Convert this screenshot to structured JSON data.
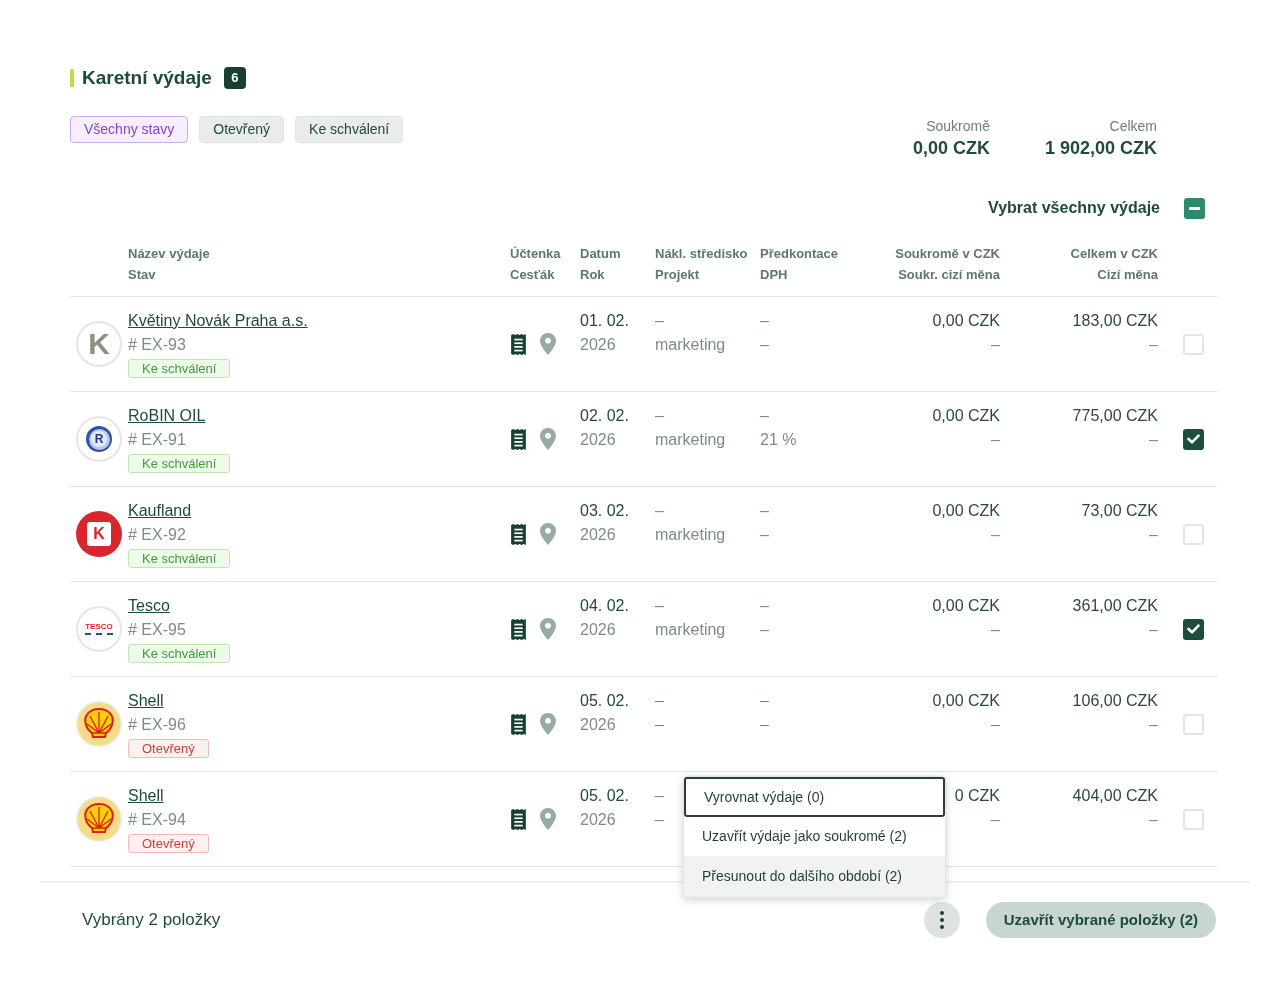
{
  "header": {
    "title": "Karetní výdaje",
    "count": "6"
  },
  "filters": [
    {
      "label": "Všechny stavy",
      "selected": true
    },
    {
      "label": "Otevřený",
      "selected": false
    },
    {
      "label": "Ke schválení",
      "selected": false
    }
  ],
  "totals": [
    {
      "label": "Soukromě",
      "value": "0,00 CZK"
    },
    {
      "label": "Celkem",
      "value": "1 902,00 CZK"
    }
  ],
  "select_all": {
    "label": "Vybrat všechny výdaje",
    "indeterminate": true
  },
  "table": {
    "columns": [
      {
        "title": "Název výdaje",
        "subtitle": "Stav",
        "kind": "text"
      },
      {
        "title": "Účtenka",
        "subtitle": "Cesťák",
        "kind": "text"
      },
      {
        "title": "Datum",
        "subtitle": "Rok",
        "kind": "text"
      },
      {
        "title": "Nákl. středisko",
        "subtitle": "Projekt",
        "kind": "text"
      },
      {
        "title": "Předkontace",
        "subtitle": "DPH",
        "kind": "text"
      },
      {
        "title": "Soukromě v CZK",
        "subtitle": "Soukr. cizí měna",
        "kind": "amount"
      },
      {
        "title": "Celkem v CZK",
        "subtitle": "Cizí měna",
        "kind": "amount"
      }
    ],
    "rows": [
      {
        "logo": {
          "kind": "letter",
          "text": "K"
        },
        "name": "Květiny Novák Praha a.s.",
        "number": "# EX-93",
        "status": {
          "label": "Ke schválení",
          "kind": "pending"
        },
        "has_receipt": true,
        "has_trip": false,
        "date": "01. 02.",
        "year": "2026",
        "cost_center": "–",
        "project": "marketing",
        "pre_account": "–",
        "vat": "–",
        "private_czk": "0,00 CZK",
        "private_foreign": "–",
        "total_czk": "183,00 CZK",
        "total_foreign": "–",
        "selected": false
      },
      {
        "logo": {
          "kind": "rings",
          "text": "R"
        },
        "name": "RoBIN OIL",
        "number": "# EX-91",
        "status": {
          "label": "Ke schválení",
          "kind": "pending"
        },
        "has_receipt": true,
        "has_trip": false,
        "date": "02. 02.",
        "year": "2026",
        "cost_center": "–",
        "project": "marketing",
        "pre_account": "–",
        "vat": "21 %",
        "private_czk": "0,00 CZK",
        "private_foreign": "–",
        "total_czk": "775,00 CZK",
        "total_foreign": "–",
        "selected": true
      },
      {
        "logo": {
          "kind": "square",
          "text": "K"
        },
        "name": "Kaufland",
        "number": "# EX-92",
        "status": {
          "label": "Ke schválení",
          "kind": "pending"
        },
        "has_receipt": true,
        "has_trip": false,
        "date": "03. 02.",
        "year": "2026",
        "cost_center": "–",
        "project": "marketing",
        "pre_account": "–",
        "vat": "–",
        "private_czk": "0,00 CZK",
        "private_foreign": "–",
        "total_czk": "73,00 CZK",
        "total_foreign": "–",
        "selected": false
      },
      {
        "logo": {
          "kind": "wordmark",
          "text": "TESCO"
        },
        "name": "Tesco",
        "number": "# EX-95",
        "status": {
          "label": "Ke schválení",
          "kind": "pending"
        },
        "has_receipt": true,
        "has_trip": false,
        "date": "04. 02.",
        "year": "2026",
        "cost_center": "–",
        "project": "marketing",
        "pre_account": "–",
        "vat": "–",
        "private_czk": "0,00 CZK",
        "private_foreign": "–",
        "total_czk": "361,00 CZK",
        "total_foreign": "–",
        "selected": true
      },
      {
        "logo": {
          "kind": "shell"
        },
        "name": "Shell",
        "number": "# EX-96",
        "status": {
          "label": "Otevřený",
          "kind": "open"
        },
        "has_receipt": true,
        "has_trip": false,
        "date": "05. 02.",
        "year": "2026",
        "cost_center": "–",
        "project": "–",
        "pre_account": "–",
        "vat": "–",
        "private_czk": "0,00 CZK",
        "private_foreign": "–",
        "total_czk": "106,00 CZK",
        "total_foreign": "–",
        "selected": false
      },
      {
        "logo": {
          "kind": "shell"
        },
        "name": "Shell",
        "number": "# EX-94",
        "status": {
          "label": "Otevřený",
          "kind": "open"
        },
        "has_receipt": true,
        "has_trip": false,
        "date": "05. 02.",
        "year": "2026",
        "cost_center": "–",
        "project": "–",
        "private_czk": "0 CZK",
        "private_foreign": "–",
        "total_czk": "404,00 CZK",
        "total_foreign": "–",
        "selected": false
      }
    ]
  },
  "menu": {
    "open": true,
    "items": [
      {
        "label": "Vyrovnat výdaje (0)",
        "focused": true,
        "hovered": false
      },
      {
        "label": "Uzavřít výdaje jako soukromé (2)",
        "focused": false,
        "hovered": false
      },
      {
        "label": "Přesunout do dalšího období (2)",
        "focused": false,
        "hovered": true
      }
    ]
  },
  "footer": {
    "selection": "Vybrány 2 položky",
    "action": "Uzavřít vybrané položky (2)"
  }
}
